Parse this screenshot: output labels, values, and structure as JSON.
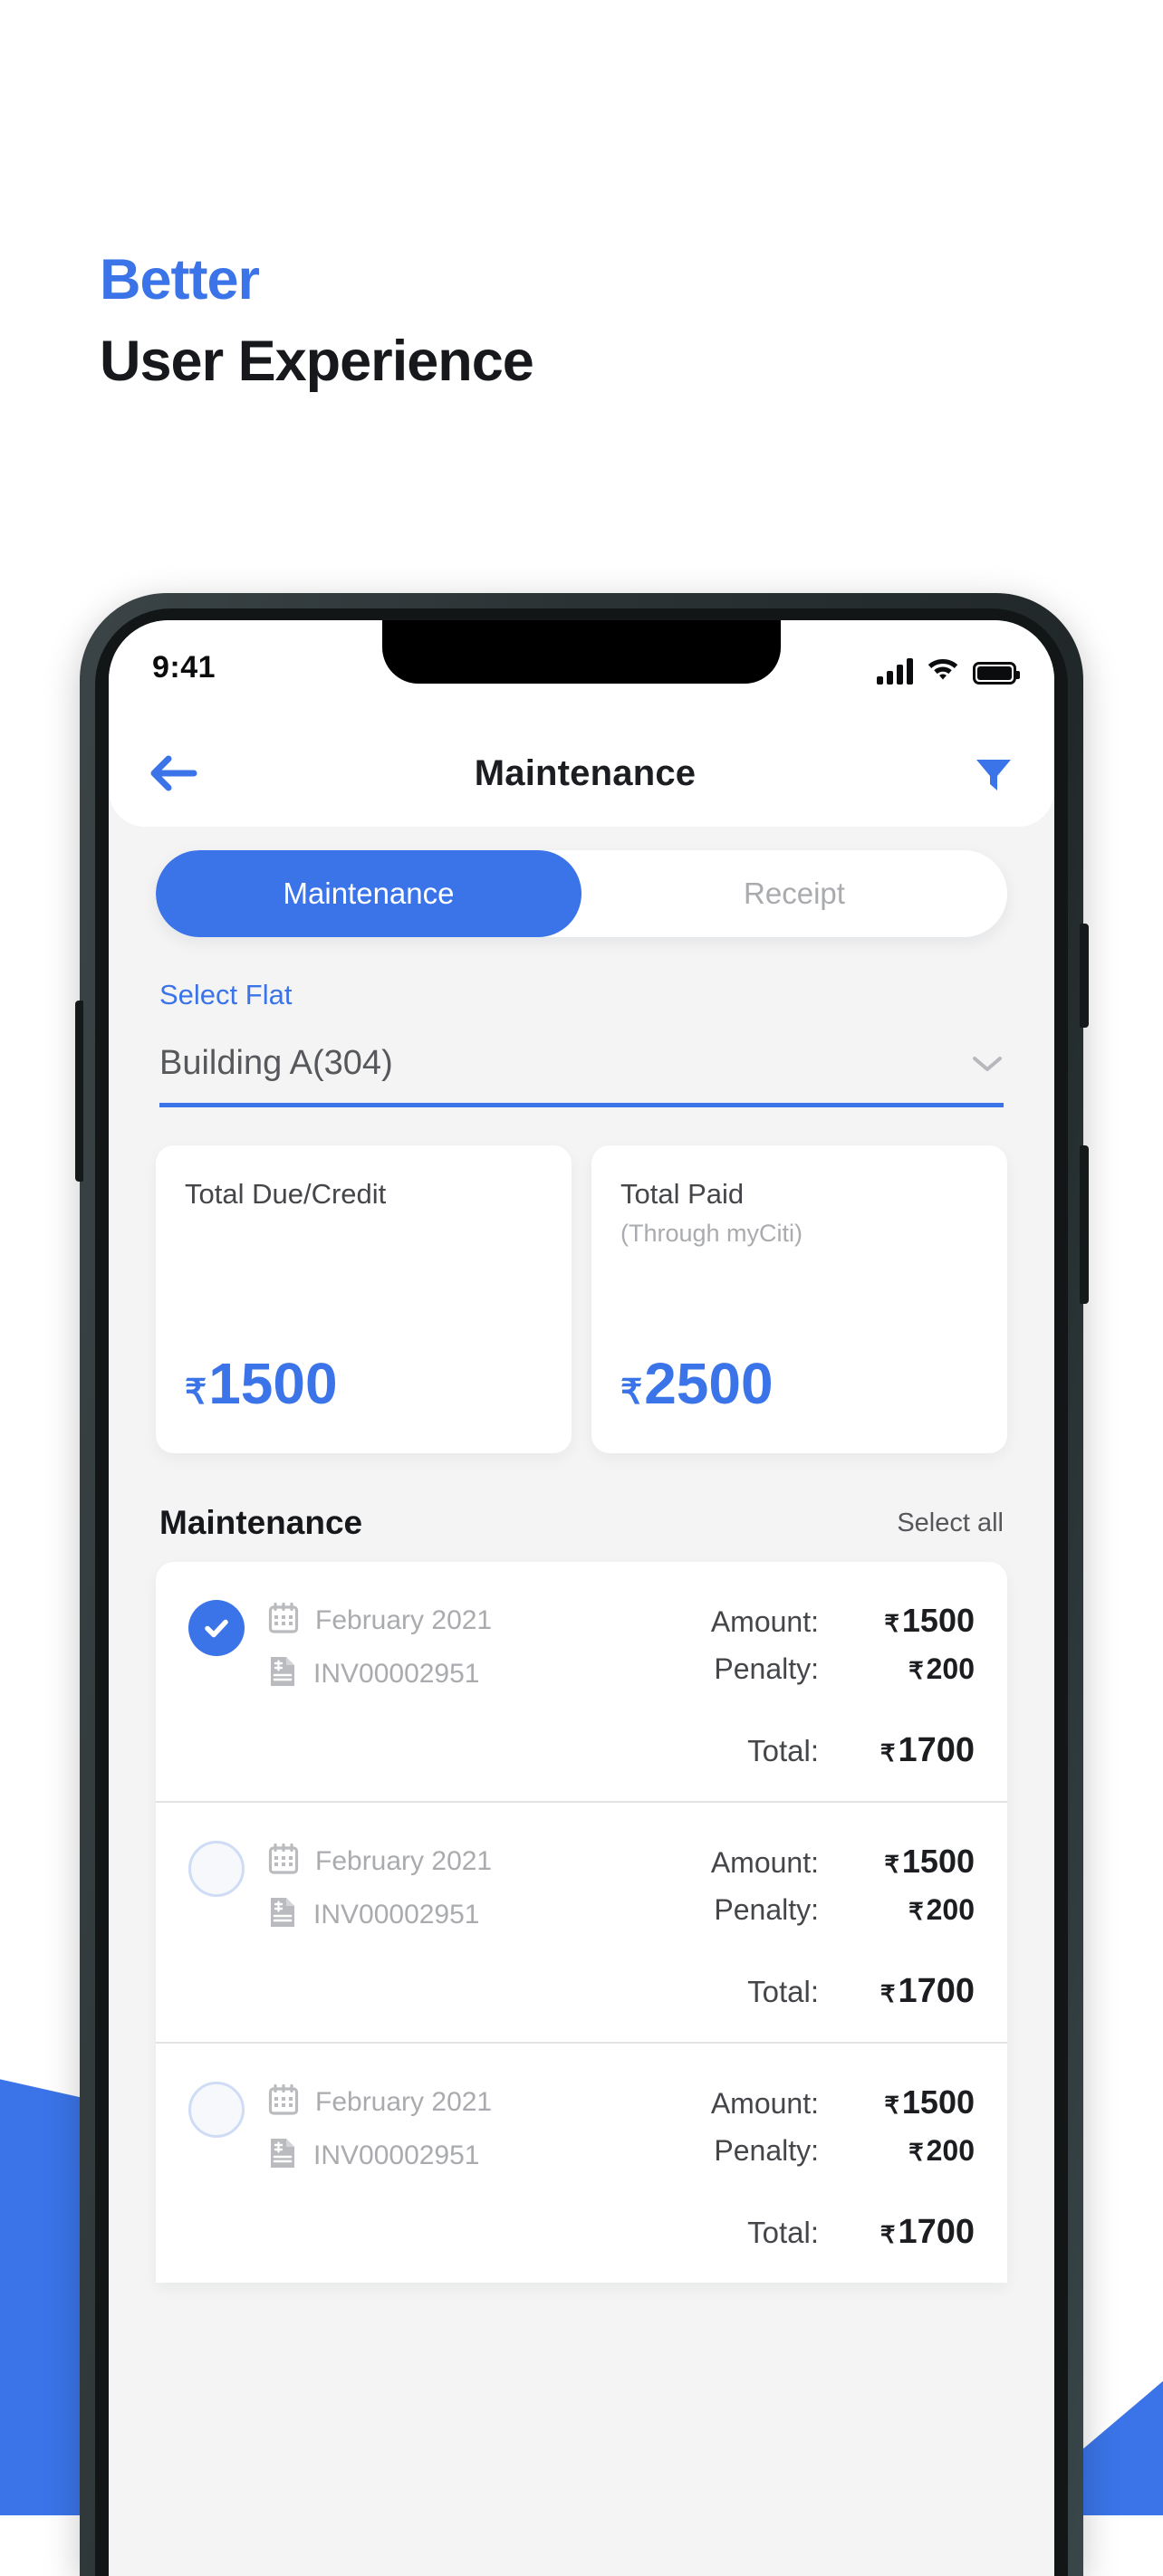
{
  "headline": {
    "line1": "Better",
    "line2": "User Experience",
    "accent_color": "#3b74e8"
  },
  "status_bar": {
    "time": "9:41",
    "cellular_icon": "signal-bars-icon",
    "wifi_icon": "wifi-icon",
    "battery_icon": "battery-full-icon"
  },
  "navbar": {
    "back_icon": "back-arrow-icon",
    "title": "Maintenance",
    "filter_icon": "filter-funnel-icon"
  },
  "tabs": [
    {
      "label": "Maintenance",
      "active": true
    },
    {
      "label": "Receipt",
      "active": false
    }
  ],
  "select_flat": {
    "label": "Select Flat",
    "value": "Building A(304)",
    "chevron_icon": "chevron-down-icon"
  },
  "summary_cards": [
    {
      "title": "Total Due/Credit",
      "subtitle": "",
      "currency": "₹",
      "amount": "1500"
    },
    {
      "title": "Total Paid",
      "subtitle": "(Through myCiti)",
      "currency": "₹",
      "amount": "2500"
    }
  ],
  "section": {
    "title": "Maintenance",
    "select_all": "Select all"
  },
  "list_labels": {
    "amount": "Amount:",
    "penalty": "Penalty:",
    "total": "Total:",
    "currency": "₹",
    "calendar_icon": "calendar-icon",
    "invoice_icon": "invoice-icon"
  },
  "rows": [
    {
      "checked": true,
      "period": "February 2021",
      "invoice": "INV00002951",
      "amount": "1500",
      "penalty": "200",
      "total": "1700"
    },
    {
      "checked": false,
      "period": "February 2021",
      "invoice": "INV00002951",
      "amount": "1500",
      "penalty": "200",
      "total": "1700"
    },
    {
      "checked": false,
      "period": "February 2021",
      "invoice": "INV00002951",
      "amount": "1500",
      "penalty": "200",
      "total": "1700"
    }
  ]
}
